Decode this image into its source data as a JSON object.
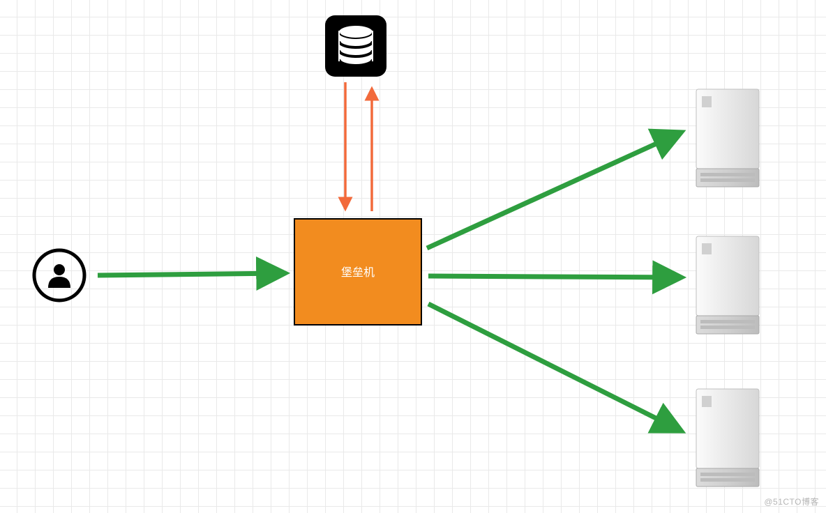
{
  "diagram": {
    "bastion_label": "堡垒机",
    "nodes": {
      "user": "user-icon",
      "database": "database-icon",
      "bastion": "bastion-host",
      "server1": "server-icon",
      "server2": "server-icon",
      "server3": "server-icon"
    },
    "arrows": {
      "user_to_bastion": "green",
      "db_to_bastion_down": "orange",
      "bastion_to_db_up": "orange",
      "bastion_to_server1": "green",
      "bastion_to_server2": "green",
      "bastion_to_server3": "green"
    },
    "colors": {
      "green": "#2e9e3f",
      "orange_fill": "#f28c1f",
      "orange_arrow": "#f26a3b",
      "black": "#000000",
      "server_light": "#f1f1f1",
      "server_dark": "#c9c9c9"
    }
  },
  "watermark": "@51CTO博客"
}
